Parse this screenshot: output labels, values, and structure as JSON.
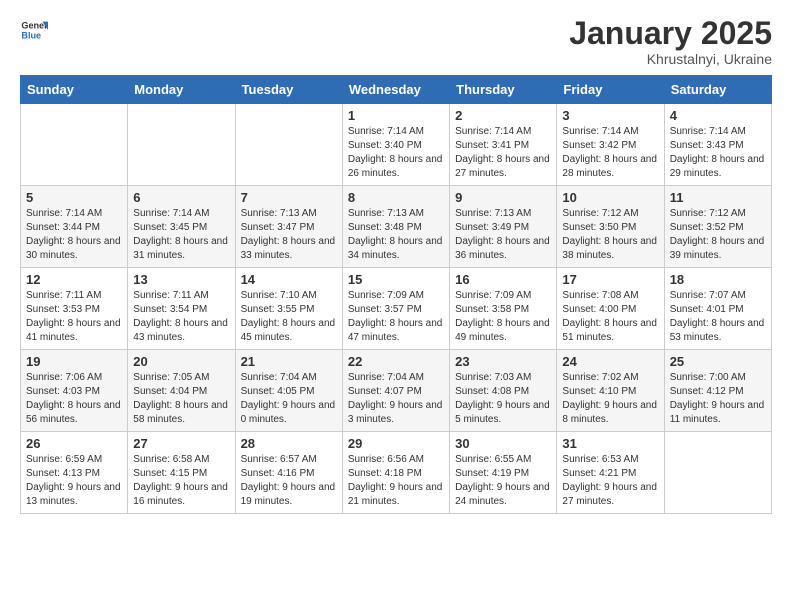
{
  "logo": {
    "general": "General",
    "blue": "Blue"
  },
  "title": "January 2025",
  "subtitle": "Khrustalnyi, Ukraine",
  "days_header": [
    "Sunday",
    "Monday",
    "Tuesday",
    "Wednesday",
    "Thursday",
    "Friday",
    "Saturday"
  ],
  "weeks": [
    [
      {
        "day": "",
        "info": ""
      },
      {
        "day": "",
        "info": ""
      },
      {
        "day": "",
        "info": ""
      },
      {
        "day": "1",
        "info": "Sunrise: 7:14 AM\nSunset: 3:40 PM\nDaylight: 8 hours and 26 minutes."
      },
      {
        "day": "2",
        "info": "Sunrise: 7:14 AM\nSunset: 3:41 PM\nDaylight: 8 hours and 27 minutes."
      },
      {
        "day": "3",
        "info": "Sunrise: 7:14 AM\nSunset: 3:42 PM\nDaylight: 8 hours and 28 minutes."
      },
      {
        "day": "4",
        "info": "Sunrise: 7:14 AM\nSunset: 3:43 PM\nDaylight: 8 hours and 29 minutes."
      }
    ],
    [
      {
        "day": "5",
        "info": "Sunrise: 7:14 AM\nSunset: 3:44 PM\nDaylight: 8 hours and 30 minutes."
      },
      {
        "day": "6",
        "info": "Sunrise: 7:14 AM\nSunset: 3:45 PM\nDaylight: 8 hours and 31 minutes."
      },
      {
        "day": "7",
        "info": "Sunrise: 7:13 AM\nSunset: 3:47 PM\nDaylight: 8 hours and 33 minutes."
      },
      {
        "day": "8",
        "info": "Sunrise: 7:13 AM\nSunset: 3:48 PM\nDaylight: 8 hours and 34 minutes."
      },
      {
        "day": "9",
        "info": "Sunrise: 7:13 AM\nSunset: 3:49 PM\nDaylight: 8 hours and 36 minutes."
      },
      {
        "day": "10",
        "info": "Sunrise: 7:12 AM\nSunset: 3:50 PM\nDaylight: 8 hours and 38 minutes."
      },
      {
        "day": "11",
        "info": "Sunrise: 7:12 AM\nSunset: 3:52 PM\nDaylight: 8 hours and 39 minutes."
      }
    ],
    [
      {
        "day": "12",
        "info": "Sunrise: 7:11 AM\nSunset: 3:53 PM\nDaylight: 8 hours and 41 minutes."
      },
      {
        "day": "13",
        "info": "Sunrise: 7:11 AM\nSunset: 3:54 PM\nDaylight: 8 hours and 43 minutes."
      },
      {
        "day": "14",
        "info": "Sunrise: 7:10 AM\nSunset: 3:55 PM\nDaylight: 8 hours and 45 minutes."
      },
      {
        "day": "15",
        "info": "Sunrise: 7:09 AM\nSunset: 3:57 PM\nDaylight: 8 hours and 47 minutes."
      },
      {
        "day": "16",
        "info": "Sunrise: 7:09 AM\nSunset: 3:58 PM\nDaylight: 8 hours and 49 minutes."
      },
      {
        "day": "17",
        "info": "Sunrise: 7:08 AM\nSunset: 4:00 PM\nDaylight: 8 hours and 51 minutes."
      },
      {
        "day": "18",
        "info": "Sunrise: 7:07 AM\nSunset: 4:01 PM\nDaylight: 8 hours and 53 minutes."
      }
    ],
    [
      {
        "day": "19",
        "info": "Sunrise: 7:06 AM\nSunset: 4:03 PM\nDaylight: 8 hours and 56 minutes."
      },
      {
        "day": "20",
        "info": "Sunrise: 7:05 AM\nSunset: 4:04 PM\nDaylight: 8 hours and 58 minutes."
      },
      {
        "day": "21",
        "info": "Sunrise: 7:04 AM\nSunset: 4:05 PM\nDaylight: 9 hours and 0 minutes."
      },
      {
        "day": "22",
        "info": "Sunrise: 7:04 AM\nSunset: 4:07 PM\nDaylight: 9 hours and 3 minutes."
      },
      {
        "day": "23",
        "info": "Sunrise: 7:03 AM\nSunset: 4:08 PM\nDaylight: 9 hours and 5 minutes."
      },
      {
        "day": "24",
        "info": "Sunrise: 7:02 AM\nSunset: 4:10 PM\nDaylight: 9 hours and 8 minutes."
      },
      {
        "day": "25",
        "info": "Sunrise: 7:00 AM\nSunset: 4:12 PM\nDaylight: 9 hours and 11 minutes."
      }
    ],
    [
      {
        "day": "26",
        "info": "Sunrise: 6:59 AM\nSunset: 4:13 PM\nDaylight: 9 hours and 13 minutes."
      },
      {
        "day": "27",
        "info": "Sunrise: 6:58 AM\nSunset: 4:15 PM\nDaylight: 9 hours and 16 minutes."
      },
      {
        "day": "28",
        "info": "Sunrise: 6:57 AM\nSunset: 4:16 PM\nDaylight: 9 hours and 19 minutes."
      },
      {
        "day": "29",
        "info": "Sunrise: 6:56 AM\nSunset: 4:18 PM\nDaylight: 9 hours and 21 minutes."
      },
      {
        "day": "30",
        "info": "Sunrise: 6:55 AM\nSunset: 4:19 PM\nDaylight: 9 hours and 24 minutes."
      },
      {
        "day": "31",
        "info": "Sunrise: 6:53 AM\nSunset: 4:21 PM\nDaylight: 9 hours and 27 minutes."
      },
      {
        "day": "",
        "info": ""
      }
    ]
  ]
}
